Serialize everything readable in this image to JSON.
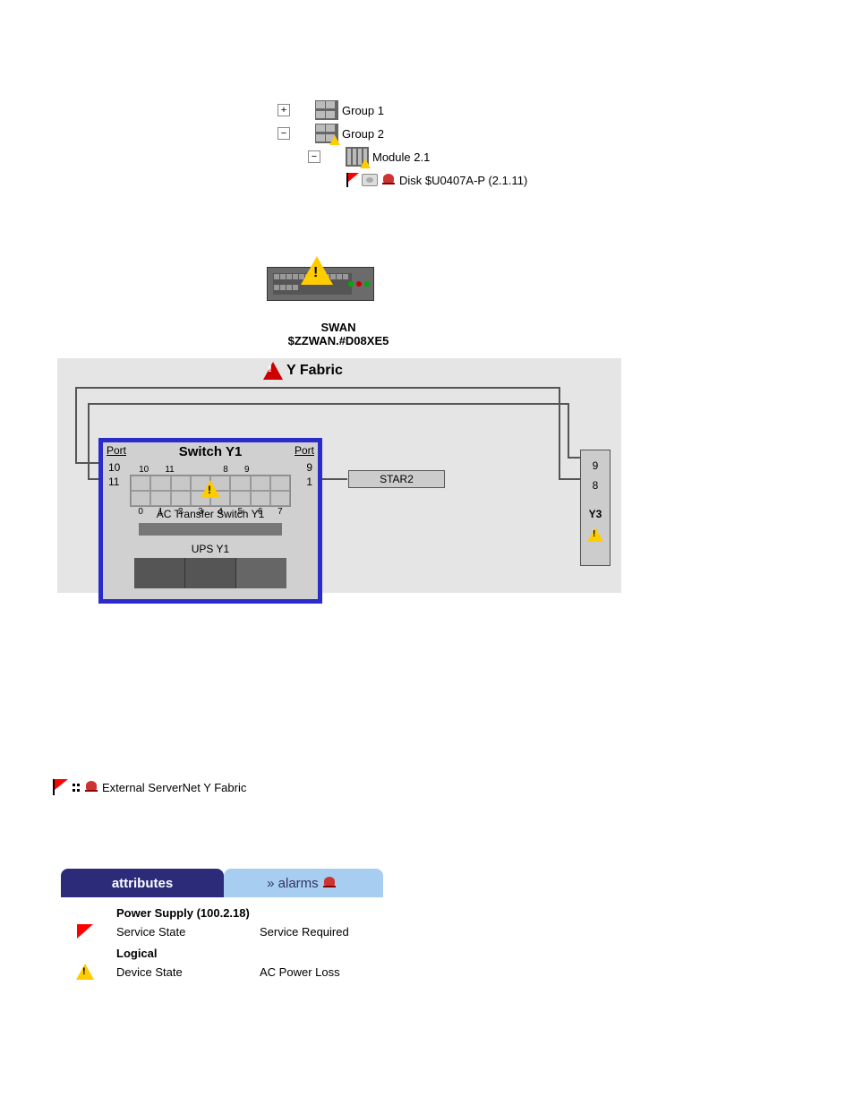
{
  "tree": {
    "group1": "Group 1",
    "group2": "Group 2",
    "module": "Module 2.1",
    "disk": "Disk $U0407A-P (2.1.11)",
    "plus": "+",
    "minus": "−"
  },
  "swan": {
    "name": "SWAN",
    "addr": "$ZZWAN.#D08XE5"
  },
  "fabric": {
    "title": "Y Fabric",
    "switch_title": "Switch Y1",
    "port_label": "Port",
    "left_ports": [
      "10",
      "11"
    ],
    "right_ports": [
      "9",
      "1"
    ],
    "top_nums": [
      "10",
      "11",
      "8",
      "9"
    ],
    "bottom_nums": [
      "0",
      "1",
      "2",
      "3",
      "4",
      "5",
      "6",
      "7"
    ],
    "ac_label": "AC Transfer Switch Y1",
    "ups_label": "UPS Y1",
    "star": "STAR2",
    "y3_top": "9",
    "y3_bottom": "8",
    "y3_label": "Y3"
  },
  "external": {
    "label": "External ServerNet Y Fabric"
  },
  "tabs": {
    "attributes": "attributes",
    "alarms": "» alarms"
  },
  "attributes": {
    "title": "Power Supply (100.2.18)",
    "row1_key": "Service State",
    "row1_val": "Service Required",
    "subsection": "Logical",
    "row2_key": "Device State",
    "row2_val": "AC Power Loss"
  }
}
